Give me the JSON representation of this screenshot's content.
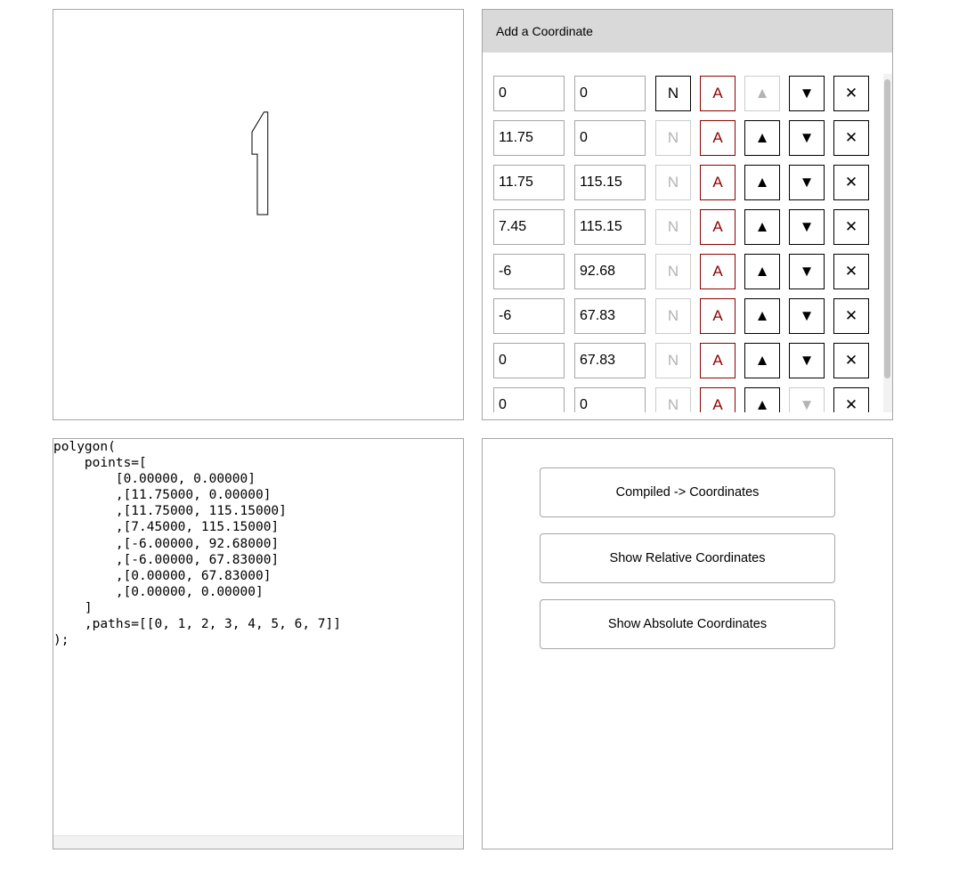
{
  "coordinates_panel": {
    "header": "Add a Coordinate",
    "row_buttons": {
      "n_label": "N",
      "a_label": "A",
      "up_icon": "▲",
      "down_icon": "▼",
      "delete_icon": "✕"
    },
    "rows": [
      {
        "x": "0",
        "y": "0",
        "n_enabled": true,
        "up_enabled": false,
        "down_enabled": true
      },
      {
        "x": "11.75",
        "y": "0",
        "n_enabled": false,
        "up_enabled": true,
        "down_enabled": true
      },
      {
        "x": "11.75",
        "y": "115.15",
        "n_enabled": false,
        "up_enabled": true,
        "down_enabled": true
      },
      {
        "x": "7.45",
        "y": "115.15",
        "n_enabled": false,
        "up_enabled": true,
        "down_enabled": true
      },
      {
        "x": "-6",
        "y": "92.68",
        "n_enabled": false,
        "up_enabled": true,
        "down_enabled": true
      },
      {
        "x": "-6",
        "y": "67.83",
        "n_enabled": false,
        "up_enabled": true,
        "down_enabled": true
      },
      {
        "x": "0",
        "y": "67.83",
        "n_enabled": false,
        "up_enabled": true,
        "down_enabled": true
      },
      {
        "x": "0",
        "y": "0",
        "n_enabled": false,
        "up_enabled": true,
        "down_enabled": false
      }
    ]
  },
  "preview": {
    "stroke_color": "#000000"
  },
  "code": {
    "text": "polygon(\n    points=[\n        [0.00000, 0.00000]\n        ,[11.75000, 0.00000]\n        ,[11.75000, 115.15000]\n        ,[7.45000, 115.15000]\n        ,[-6.00000, 92.68000]\n        ,[-6.00000, 67.83000]\n        ,[0.00000, 67.83000]\n        ,[0.00000, 0.00000]\n    ]\n    ,paths=[[0, 1, 2, 3, 4, 5, 6, 7]]\n);"
  },
  "actions": {
    "compiled_label": "Compiled -> Coordinates",
    "relative_label": "Show Relative Coordinates",
    "absolute_label": "Show Absolute Coordinates"
  }
}
